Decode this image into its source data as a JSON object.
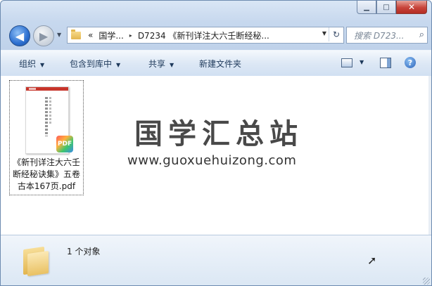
{
  "window": {
    "caption_buttons": {
      "minimize": "▁",
      "maximize": "□",
      "close": "✕"
    }
  },
  "nav": {
    "back_glyph": "◀",
    "forward_glyph": "▶",
    "dropdown_glyph": "▼",
    "address": {
      "overflow_glyph": "«",
      "crumbs": [
        "国学...",
        "D7234 《新刊详注大六壬断经秘..."
      ],
      "separator": "▸",
      "dropdown_glyph": "▼",
      "refresh_glyph": "↻"
    },
    "search": {
      "placeholder": "搜索 D723...",
      "icon": "search-icon",
      "glyph": "⌕"
    }
  },
  "toolbar": {
    "organize": "组织",
    "include_in_library": "包含到库中",
    "share": "共享",
    "new_folder": "新建文件夹",
    "dropdown_glyph": "▼",
    "help_glyph": "?"
  },
  "content": {
    "files": [
      {
        "name": "《新刊详注大六壬断经秘诀集》五卷古本167页.pdf",
        "type": "pdf",
        "badge": "PDF"
      }
    ],
    "watermark": {
      "title": "国学汇总站",
      "url": "www.guoxuehuizong.com"
    }
  },
  "details": {
    "count_text": "1 个对象"
  },
  "colors": {
    "accent": "#2c6fd0",
    "toolbar_text": "#1e395b",
    "close_button": "#c7433a"
  }
}
